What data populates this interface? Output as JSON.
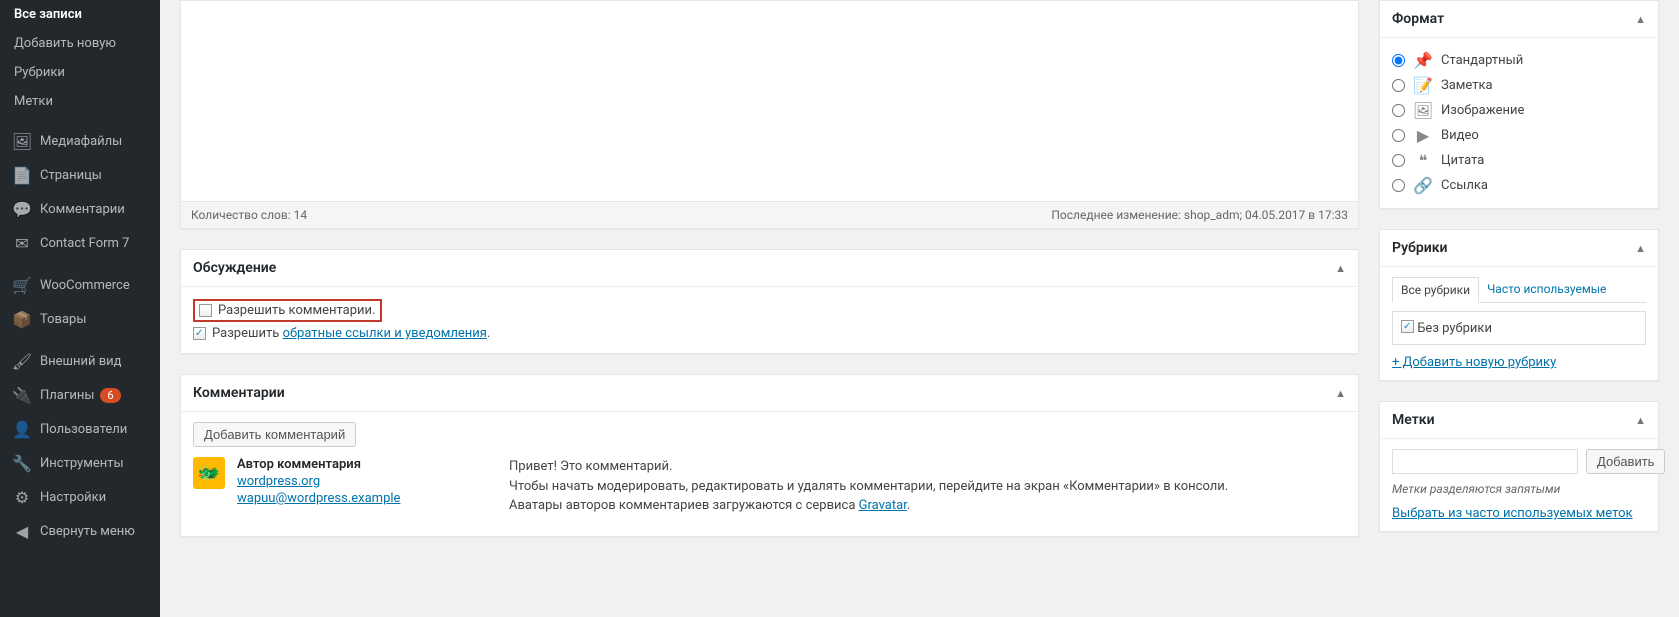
{
  "sidebar": {
    "posts": {
      "all": "Все записи",
      "add": "Добавить новую",
      "categories": "Рубрики",
      "tags": "Метки"
    },
    "media": "Медиафайлы",
    "pages": "Страницы",
    "comments": "Комментарии",
    "cf7": "Contact Form 7",
    "woo": "WooCommerce",
    "products": "Товары",
    "appearance": "Внешний вид",
    "plugins": "Плагины",
    "plugins_badge": "6",
    "users": "Пользователи",
    "tools": "Инструменты",
    "settings": "Настройки",
    "collapse": "Свернуть меню"
  },
  "editor": {
    "wordcount_label": "Количество слов: 14",
    "lastmod": "Последнее изменение: shop_adm; 04.05.2017 в 17:33"
  },
  "discussion": {
    "title": "Обсуждение",
    "allow_comments": "Разрешить комментарии.",
    "allow_prefix": "Разрешить ",
    "pingbacks_link": "обратные ссылки и уведомления",
    "pingbacks_suffix": "."
  },
  "comments": {
    "title": "Комментарии",
    "add_button": "Добавить комментарий",
    "author_label": "Автор комментария",
    "author_site": "wordpress.org",
    "author_email": "wapuu@wordpress.example",
    "body1": "Привет! Это комментарий.",
    "body2": "Чтобы начать модерировать, редактировать и удалять комментарии, перейдите на экран «Комментарии» в консоли.",
    "body3_prefix": "Аватары авторов комментариев загружаются с сервиса ",
    "body3_link": "Gravatar",
    "body3_suffix": "."
  },
  "format": {
    "title": "Формат",
    "standard": "Стандартный",
    "aside": "Заметка",
    "image": "Изображение",
    "video": "Видео",
    "quote": "Цитата",
    "link": "Ссылка"
  },
  "categories": {
    "title": "Рубрики",
    "tab_all": "Все рубрики",
    "tab_frequent": "Часто используемые",
    "uncategorized": "Без рубрики",
    "add_new": "+ Добавить новую рубрику"
  },
  "tags": {
    "title": "Метки",
    "add_button": "Добавить",
    "howto": "Метки разделяются запятыми",
    "choose": "Выбрать из часто используемых меток"
  }
}
